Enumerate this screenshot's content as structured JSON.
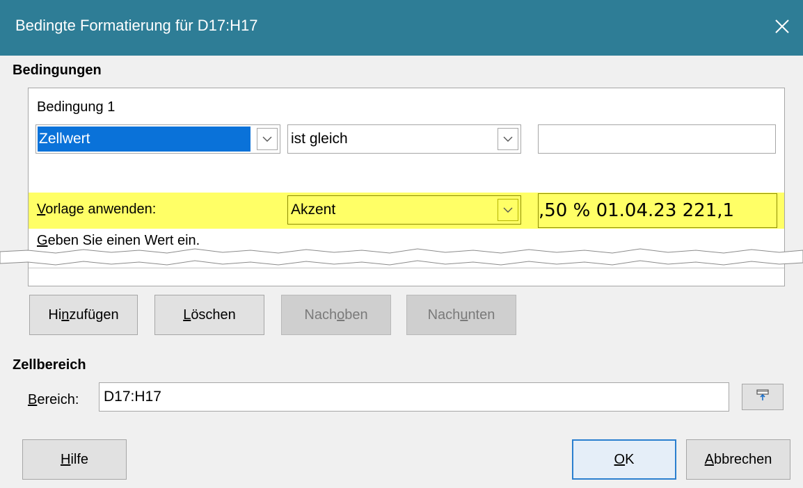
{
  "window": {
    "title": "Bedingte Formatierung für D17:H17",
    "close_icon": "close-icon"
  },
  "conditions": {
    "section_title": "Bedingungen",
    "condition_header": "Bedingung 1",
    "type_combo_value": "Zellwert",
    "operator_combo_value": "ist gleich",
    "value_input": "",
    "apply_style_label_accel": "V",
    "apply_style_label_rest": "orlage anwenden:",
    "style_combo_value": "Akzent",
    "style_preview_text": ",50 % 01.04.23 221,1",
    "hint_accel": "G",
    "hint_rest": "eben Sie einen Wert ein.",
    "highlight_color": "#ffff66",
    "selection_color": "#0a72d9"
  },
  "list_buttons": {
    "add_pre": "Hi",
    "add_accel": "n",
    "add_post": "zufügen",
    "delete_pre": "",
    "delete_accel": "L",
    "delete_post": "öschen",
    "up_pre": "Nach ",
    "up_accel": "o",
    "up_post": "ben",
    "down_pre": "Nach ",
    "down_accel": "u",
    "down_post": "nten"
  },
  "cell_range": {
    "section_title": "Zellbereich",
    "label_accel": "B",
    "label_rest": "ereich:",
    "value": "D17:H17",
    "shrink_icon": "shrink-icon"
  },
  "footer": {
    "help_accel": "H",
    "help_rest": "ilfe",
    "ok_accel": "O",
    "ok_rest": "K",
    "cancel_accel": "A",
    "cancel_rest": "bbrechen"
  },
  "colors": {
    "title_bar": "#2e7d96",
    "dialog_bg": "#f0f0f0",
    "default_button_border": "#2a7fcf"
  }
}
